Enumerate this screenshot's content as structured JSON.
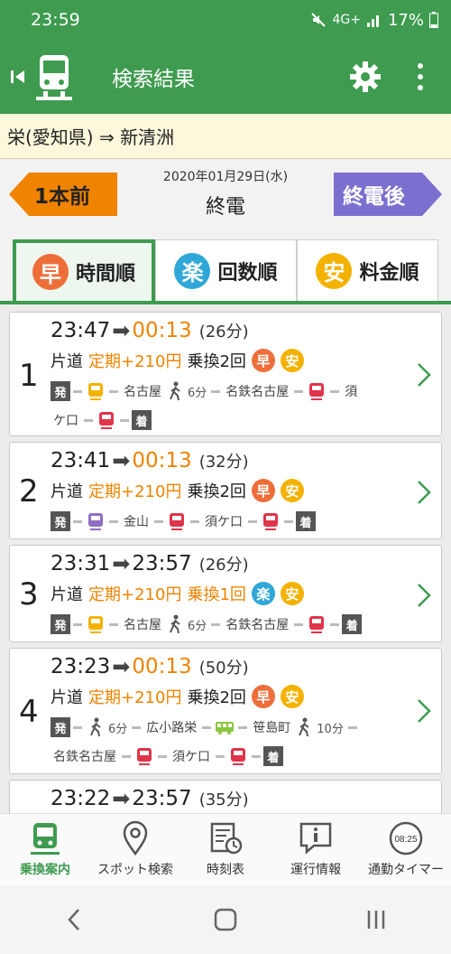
{
  "status": {
    "time": "23:59",
    "battery": "17%",
    "net": "4G+"
  },
  "appbar": {
    "title": "検索結果"
  },
  "route": {
    "text": "栄(愛知県) ⇒ 新清洲"
  },
  "timebar": {
    "prev_label": "1本前",
    "next_label": "終電後",
    "date": "2020年01月29日(水)",
    "mode": "終電",
    "prev_color": "#f08300",
    "next_color": "#7b6fcf"
  },
  "tabs": [
    {
      "badge": "早",
      "label": "時間順",
      "color": "#ee6e3a",
      "active": true
    },
    {
      "badge": "楽",
      "label": "回数順",
      "color": "#2fa7d8",
      "active": false
    },
    {
      "badge": "安",
      "label": "料金順",
      "color": "#f4b200",
      "active": false
    }
  ],
  "results": [
    {
      "num": "1",
      "dep": "23:47",
      "arr": "00:13",
      "dur": "(26分)",
      "trip": "片道",
      "fare": "定期+210円",
      "transfer": "乗換2回",
      "seg1": {
        "start": "発",
        "st1": "名古屋",
        "walk": "6分",
        "st2": "名鉄名古屋",
        "st3": "須"
      },
      "seg2": {
        "st": "ケ口",
        "end": "着"
      }
    },
    {
      "num": "2",
      "dep": "23:41",
      "arr": "00:13",
      "dur": "(32分)",
      "trip": "片道",
      "fare": "定期+210円",
      "transfer": "乗換2回",
      "seg1": {
        "start": "発",
        "st1": "金山",
        "st2": "須ケ口",
        "end": "着"
      }
    },
    {
      "num": "3",
      "dep": "23:31",
      "arr": "23:57",
      "dur": "(26分)",
      "trip": "片道",
      "fare": "定期+210円",
      "transfer": "乗換1回",
      "seg1": {
        "start": "発",
        "st1": "名古屋",
        "walk": "6分",
        "st2": "名鉄名古屋",
        "end": "着"
      }
    },
    {
      "num": "4",
      "dep": "23:23",
      "arr": "00:13",
      "dur": "(50分)",
      "trip": "片道",
      "fare": "定期+210円",
      "transfer": "乗換2回",
      "seg1": {
        "start": "発",
        "walk1": "6分",
        "st1": "広小路栄",
        "st2": "笹島町",
        "walk2": "10分"
      },
      "seg2": {
        "st1": "名鉄名古屋",
        "st2": "須ケ口",
        "end": "着"
      }
    },
    {
      "num": "5",
      "dep": "23:22",
      "arr": "23:57",
      "dur": "(35分)"
    }
  ],
  "badges": {
    "haya": "早",
    "an": "安",
    "raku": "楽"
  },
  "bottomnav": [
    {
      "label": "乗換案内",
      "icon": "train-icon",
      "active": true
    },
    {
      "label": "スポット検索",
      "icon": "pin-icon",
      "active": false
    },
    {
      "label": "時刻表",
      "icon": "timetable-icon",
      "active": false
    },
    {
      "label": "運行情報",
      "icon": "info-icon",
      "active": false
    },
    {
      "label": "通勤タイマー",
      "icon": "timer-icon",
      "active": false
    }
  ],
  "timer_text": "08:25"
}
